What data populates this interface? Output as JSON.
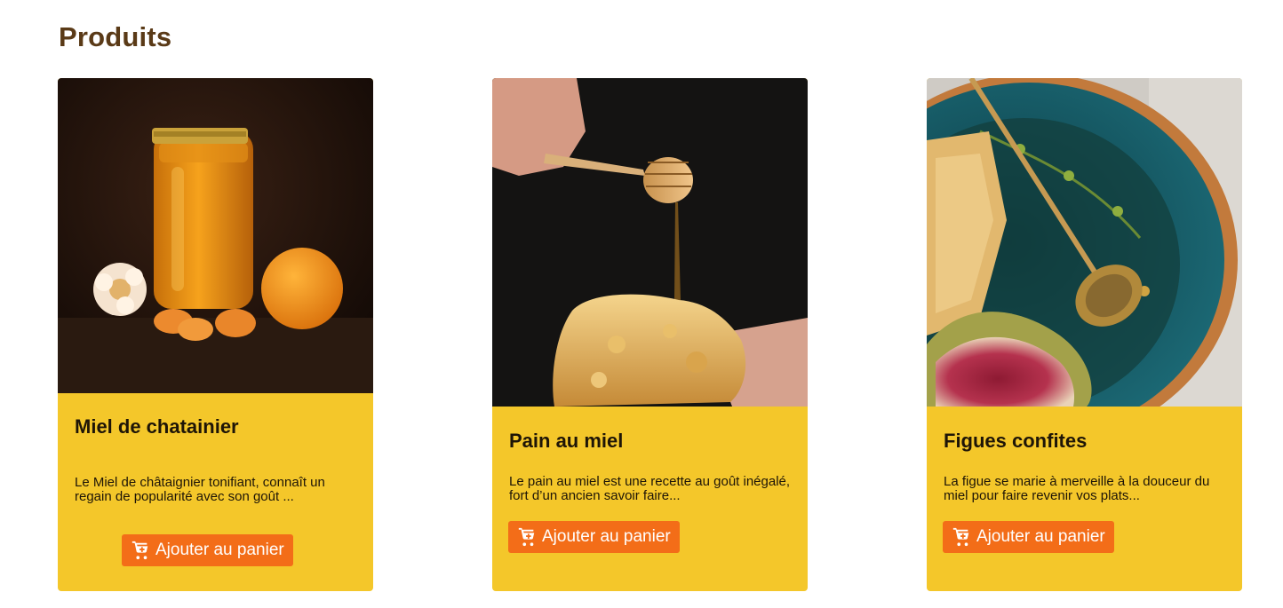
{
  "section": {
    "title": "Produits"
  },
  "products": [
    {
      "title": "Miel de chatainier",
      "description": "Le Miel de châtaignier tonifiant, connaît un regain de popularité avec son goût ...",
      "button_label": "Ajouter au panier",
      "image": "honey-jar-with-orange-and-flower"
    },
    {
      "title": "Pain au miel",
      "description": "Le pain au miel est une recette au goût inégalé, fort d’un ancien savoir faire...",
      "button_label": "Ajouter au panier",
      "image": "honey-dipper-over-bread"
    },
    {
      "title": "Figues confites",
      "description": "La figue se marie à merveille à la douceur du miel pour faire revenir vos plats...",
      "button_label": "Ajouter au panier",
      "image": "fig-honeycomb-honey-dipper-in-bowl"
    }
  ],
  "colors": {
    "title": "#5a3a17",
    "card_background": "#f4c72a",
    "button": "#f36d18",
    "button_text": "#ffffff"
  },
  "icons": {
    "cart": "cart-plus-icon"
  }
}
